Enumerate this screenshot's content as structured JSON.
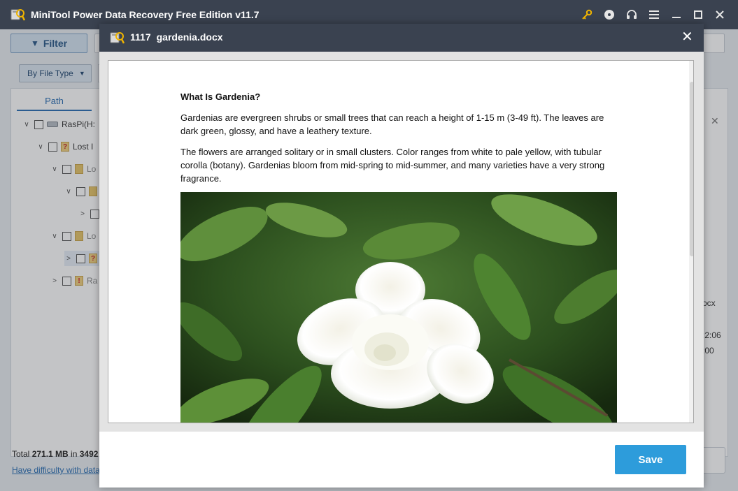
{
  "app": {
    "title": "MiniTool Power Data Recovery Free Edition v11.7",
    "icons": [
      "key-icon",
      "disc-icon",
      "headset-icon",
      "menu-icon",
      "minimize-icon",
      "maximize-icon",
      "close-icon"
    ]
  },
  "toolbar": {
    "filter_label": "Filter",
    "by_file_type_label": "By File Type"
  },
  "tree": {
    "tab_label": "Path",
    "items": [
      {
        "label": "RasPi(H:",
        "expanded": true
      },
      {
        "label": "Lost I",
        "expanded": true
      },
      {
        "label": "Lo",
        "expanded": true
      },
      {
        "label": "",
        "expanded": true
      },
      {
        "label": "",
        "expanded": false
      },
      {
        "label": "Lo",
        "expanded": true
      },
      {
        "label": "?",
        "expanded": false
      },
      {
        "label": "Ra",
        "expanded": false
      }
    ]
  },
  "status": {
    "total_prefix": "Total ",
    "total_size": "271.1 MB",
    "total_in": " in ",
    "total_count": "3492",
    "help_link": "Have difficulty with data"
  },
  "right_panel": {
    "ext": "ocx",
    "time1": ":2:06",
    "time2": ":00"
  },
  "preview": {
    "file_number": "1117",
    "file_name": "gardenia.docx",
    "save_label": "Save",
    "document": {
      "heading": "What Is Gardenia?",
      "paragraph1": "Gardenias are evergreen shrubs or small trees that can reach a height of 1-15 m (3-49 ft). The leaves are dark green, glossy, and have a leathery texture.",
      "paragraph2": "The flowers are arranged solitary or in small clusters. Color ranges from white to pale yellow, with tubular corolla (botany). Gardenias bloom from mid-spring to mid-summer, and many varieties have a very strong fragrance."
    }
  },
  "colors": {
    "titlebar": "#3a4250",
    "accent": "#2d9cdb",
    "link": "#2b6fb4"
  }
}
